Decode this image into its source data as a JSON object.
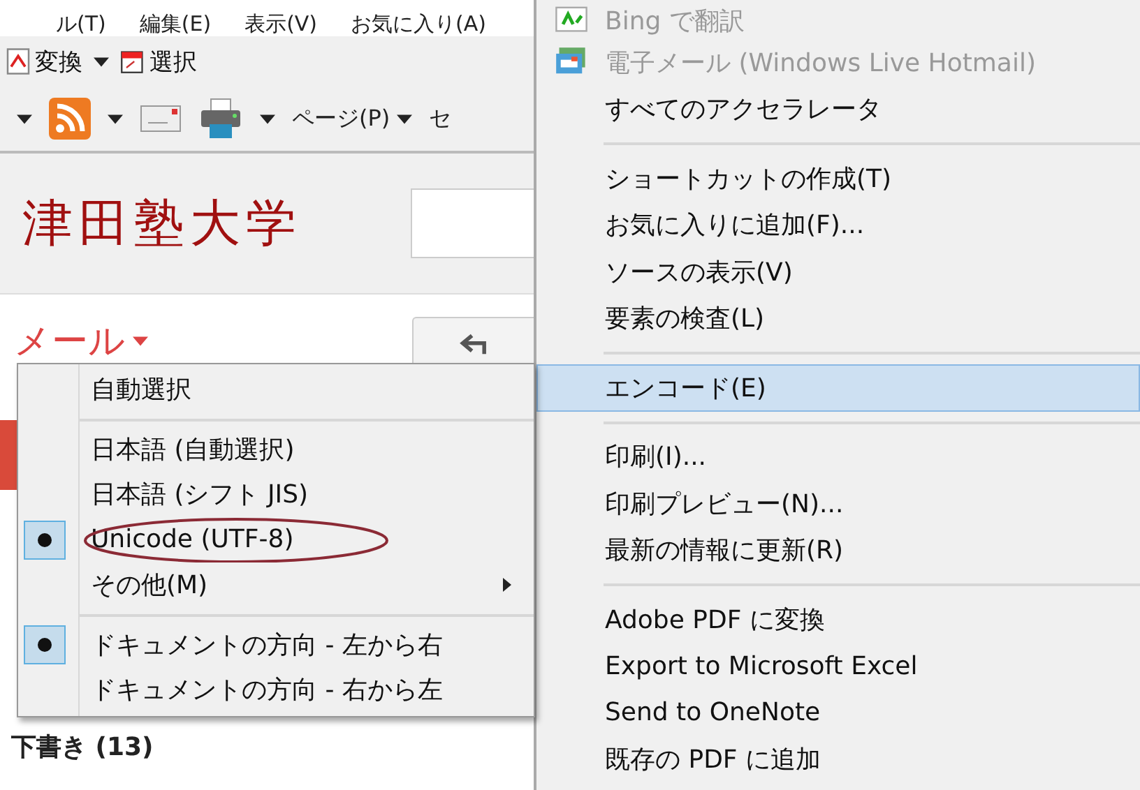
{
  "browser": {
    "menu_bar": [
      "ル(T)",
      "編集(E)",
      "表示(V)",
      "お気に入り(A)"
    ],
    "pdf_toolbar": [
      {
        "kind": "convert",
        "label": "変換"
      },
      {
        "kind": "select",
        "label": "選択"
      }
    ],
    "command_bar": {
      "page_menu": "ページ(P)",
      "cut_menu": "セ"
    }
  },
  "page": {
    "logo": "津田塾大学",
    "mail_menu": "メール",
    "folder": "下書き (13)"
  },
  "context_menu": {
    "items": [
      {
        "kind": "item",
        "label": "Bing で翻訳",
        "disabled": true,
        "selected": false
      },
      {
        "kind": "item",
        "label": "電子メール (Windows Live Hotmail)",
        "disabled": true,
        "selected": false
      },
      {
        "kind": "item",
        "label": "すべてのアクセラレータ",
        "disabled": false,
        "selected": false
      },
      {
        "kind": "separator"
      },
      {
        "kind": "item",
        "label": "ショートカットの作成(T)",
        "disabled": false,
        "selected": false
      },
      {
        "kind": "item",
        "label": "お気に入りに追加(F)...",
        "disabled": false,
        "selected": false
      },
      {
        "kind": "item",
        "label": "ソースの表示(V)",
        "disabled": false,
        "selected": false
      },
      {
        "kind": "item",
        "label": "要素の検査(L)",
        "disabled": false,
        "selected": false
      },
      {
        "kind": "separator"
      },
      {
        "kind": "item",
        "label": "エンコード(E)",
        "disabled": false,
        "selected": true
      },
      {
        "kind": "separator"
      },
      {
        "kind": "item",
        "label": "印刷(I)...",
        "disabled": false,
        "selected": false
      },
      {
        "kind": "item",
        "label": "印刷プレビュー(N)...",
        "disabled": false,
        "selected": false
      },
      {
        "kind": "item",
        "label": "最新の情報に更新(R)",
        "disabled": false,
        "selected": false
      },
      {
        "kind": "separator"
      },
      {
        "kind": "item",
        "label": "Adobe PDF に変換",
        "disabled": false,
        "selected": false
      },
      {
        "kind": "item",
        "label": "Export to Microsoft Excel",
        "disabled": false,
        "selected": false
      },
      {
        "kind": "item",
        "label": "Send to OneNote",
        "disabled": false,
        "selected": false
      },
      {
        "kind": "item",
        "label": "既存の PDF に追加",
        "disabled": false,
        "selected": false
      }
    ]
  },
  "encoding_menu": {
    "items": [
      {
        "kind": "item",
        "label": "自動選択",
        "checked": false,
        "submenu": false,
        "circled": false
      },
      {
        "kind": "separator"
      },
      {
        "kind": "item",
        "label": "日本語 (自動選択)",
        "checked": false,
        "submenu": false,
        "circled": false
      },
      {
        "kind": "item",
        "label": "日本語 (シフト JIS)",
        "checked": false,
        "submenu": false,
        "circled": false
      },
      {
        "kind": "item",
        "label": "Unicode (UTF-8)",
        "checked": true,
        "submenu": false,
        "circled": true
      },
      {
        "kind": "item",
        "label": "その他(M)",
        "checked": false,
        "submenu": true,
        "circled": false
      },
      {
        "kind": "separator"
      },
      {
        "kind": "item",
        "label": "ドキュメントの方向 - 左から右",
        "checked": true,
        "submenu": false,
        "circled": false
      },
      {
        "kind": "item",
        "label": "ドキュメントの方向 - 右から左",
        "checked": false,
        "submenu": false,
        "circled": false
      }
    ]
  }
}
